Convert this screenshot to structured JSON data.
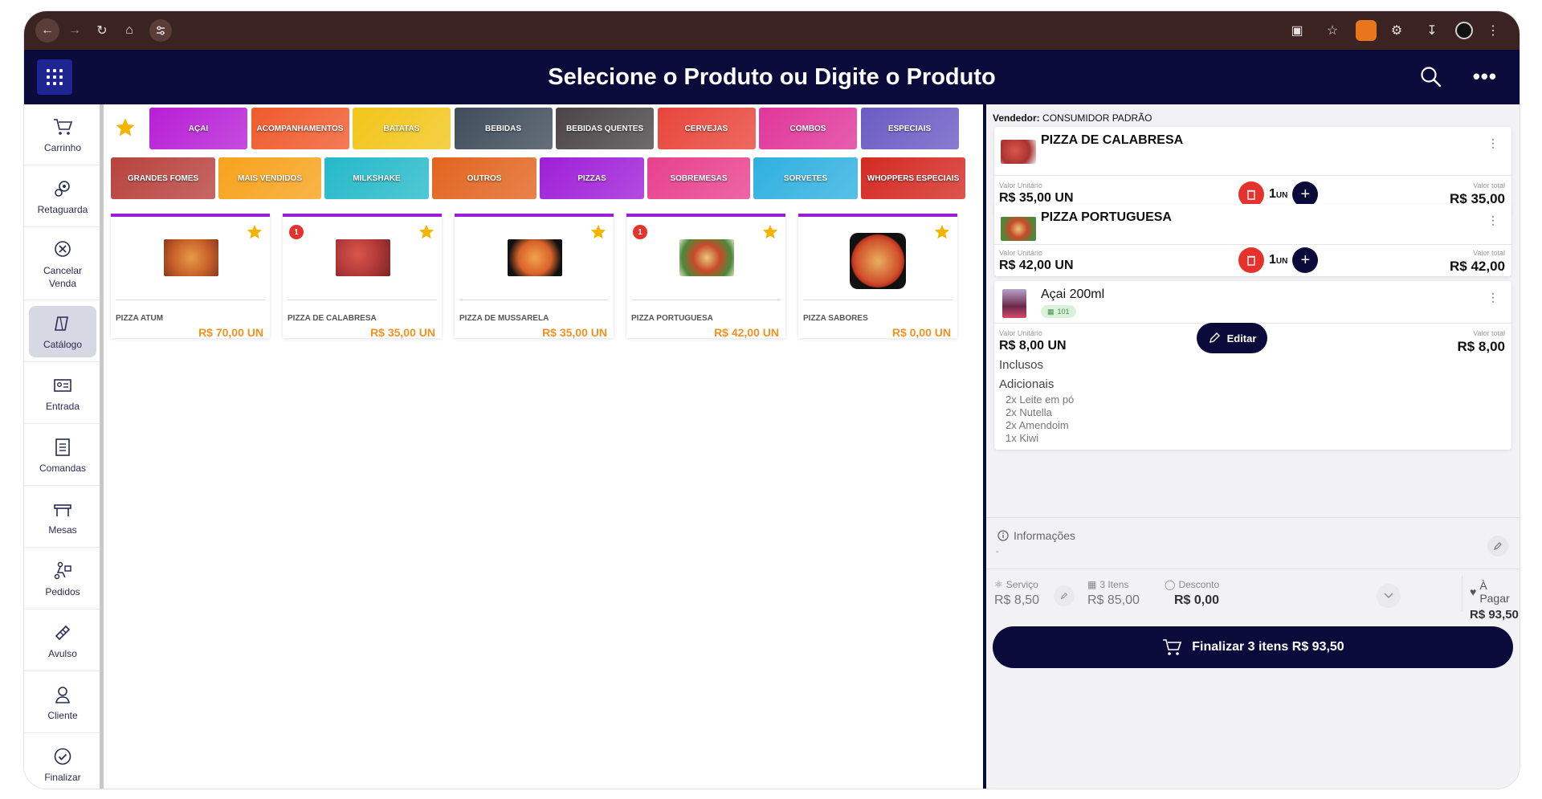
{
  "header": {
    "title": "Selecione o Produto ou Digite o Produto"
  },
  "sidebar": {
    "items": [
      {
        "label": "Carrinho",
        "icon": "cart-icon"
      },
      {
        "label": "Retaguarda",
        "icon": "gears-icon"
      },
      {
        "label": "Cancelar Venda",
        "icon": "cancel-icon"
      },
      {
        "label": "Catálogo",
        "icon": "catalog-icon",
        "active": true
      },
      {
        "label": "Entrada",
        "icon": "id-card-icon"
      },
      {
        "label": "Comandas",
        "icon": "list-icon"
      },
      {
        "label": "Mesas",
        "icon": "table-icon"
      },
      {
        "label": "Pedidos",
        "icon": "delivery-icon"
      },
      {
        "label": "Avulso",
        "icon": "ticket-icon"
      },
      {
        "label": "Cliente",
        "icon": "user-icon"
      },
      {
        "label": "Finalizar",
        "icon": "check-icon"
      }
    ]
  },
  "categories_row1": [
    "AÇAI",
    "ACOMPANHAMENTOS",
    "BATATAS",
    "BEBIDAS",
    "BEBIDAS QUENTES",
    "CERVEJAS",
    "COMBOS",
    "ESPECIAIS"
  ],
  "categories_row2": [
    "GRANDES FOMES",
    "MAIS VENDIDOS",
    "MILKSHAKE",
    "OUTROS",
    "PIZZAS",
    "SOBREMESAS",
    "SORVETES",
    "WHOPPERS ESPECIAIS"
  ],
  "category_colors": {
    "row1": [
      "#b71fd6",
      "#f05a2c",
      "#f2c519",
      "#3f4c5a",
      "#4b4548",
      "#e8453a",
      "#e0369a",
      "#6b5bc4"
    ],
    "row2": [
      "#b8423d",
      "#f7a21b",
      "#25b9c9",
      "#e2641f",
      "#9f1fd8",
      "#e8408e",
      "#2fb0e0",
      "#d42a22"
    ]
  },
  "products": [
    {
      "name": "PIZZA ATUM",
      "price": "R$ 70,00 UN",
      "badge": ""
    },
    {
      "name": "PIZZA DE CALABRESA",
      "price": "R$ 35,00 UN",
      "badge": "1"
    },
    {
      "name": "PIZZA DE MUSSARELA",
      "price": "R$ 35,00 UN",
      "badge": ""
    },
    {
      "name": "PIZZA PORTUGUESA",
      "price": "R$ 42,00 UN",
      "badge": "1"
    },
    {
      "name": "PIZZA SABORES",
      "price": "R$ 0,00 UN",
      "badge": ""
    }
  ],
  "cart": {
    "vendedor_label": "Vendedor:",
    "vendedor": "CONSUMIDOR PADRÃO",
    "unit_label": "Valor Unitário",
    "total_label": "Valor total",
    "items": [
      {
        "name": "PIZZA DE CALABRESA",
        "unit": "R$ 35,00 UN",
        "qty": "1",
        "qty_unit": "UN",
        "total": "R$ 35,00"
      },
      {
        "name": "PIZZA PORTUGUESA",
        "unit": "R$ 42,00 UN",
        "qty": "1",
        "qty_unit": "UN",
        "total": "R$ 42,00"
      },
      {
        "name": "Açai 200ml",
        "chip": "101",
        "unit": "R$ 8,00 UN",
        "total": "R$ 8,00",
        "edit_label": "Editar",
        "inclusos_label": "Inclusos",
        "adicionais_label": "Adicionais",
        "adicionais": [
          "2x Leite em pó",
          "2x Nutella",
          "2x Amendoim",
          "1x Kiwi"
        ]
      }
    ],
    "info_label": "Informações",
    "info_value": "-",
    "servico_label": "Serviço",
    "servico_value": "R$ 8,50",
    "itens_label": "3 Itens",
    "itens_value": "R$ 85,00",
    "desconto_label": "Desconto",
    "desconto_value": "R$ 0,00",
    "pagar_label": "À Pagar",
    "pagar_value": "R$ 93,50",
    "finalizar_label": "Finalizar 3 itens R$ 93,50"
  },
  "colors": {
    "navy": "#0a0b3a",
    "accent_purple": "#9a1dd9",
    "price_orange": "#f39220",
    "delete_red": "#e5322d",
    "star": "#f5b400"
  }
}
